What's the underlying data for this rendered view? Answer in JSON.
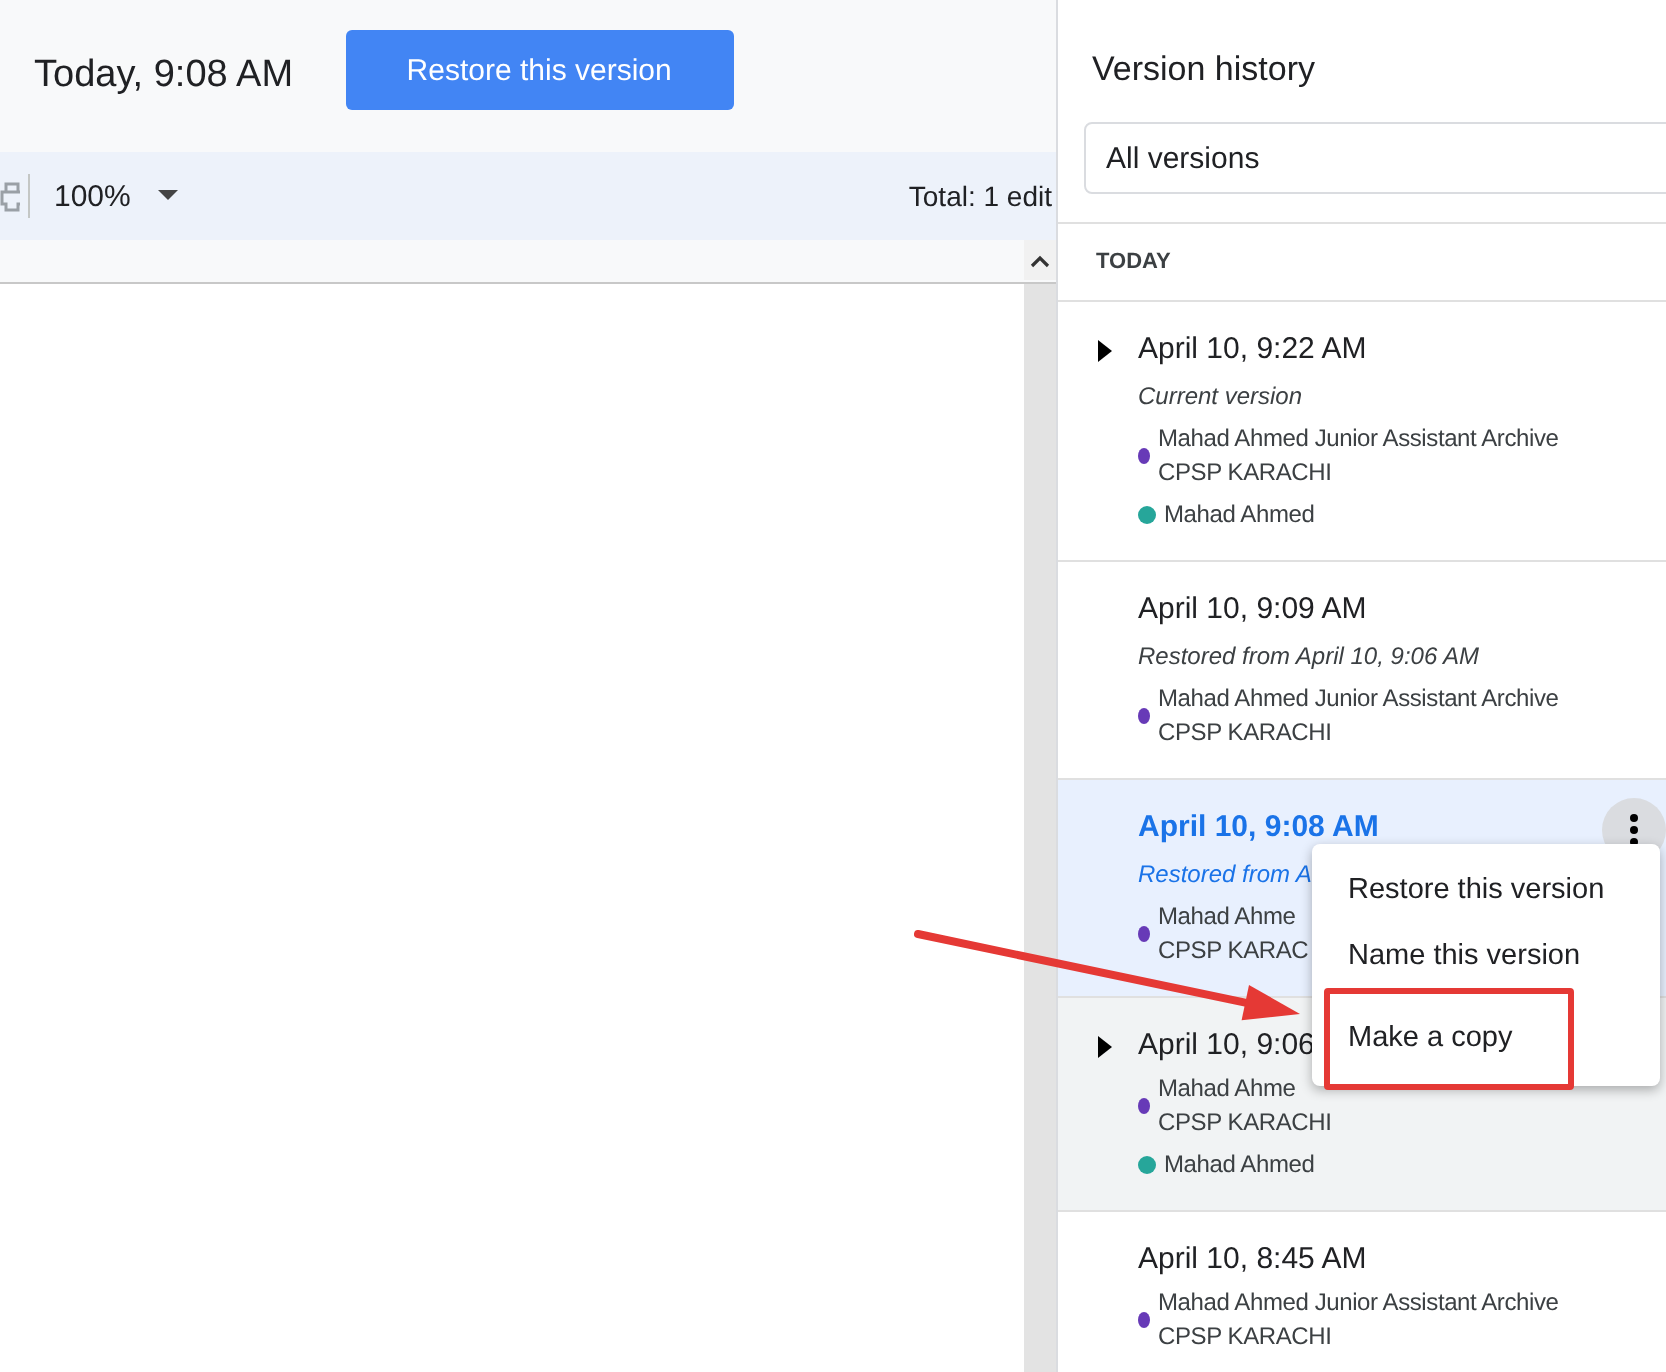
{
  "header": {
    "title": "Today, 9:08 AM",
    "restore_button": "Restore this version"
  },
  "toolbar": {
    "zoom": "100%",
    "total": "Total: 1 edit"
  },
  "panel": {
    "title": "Version history",
    "filter": "All versions",
    "section": "TODAY",
    "versions": [
      {
        "time": "April 10, 9:22 AM",
        "note": "Current version",
        "expandable": true,
        "selected": false,
        "hovered": false,
        "editors": [
          {
            "lines": [
              "Mahad Ahmed Junior Assistant Archive",
              "CPSP KARACHI"
            ],
            "color": "#673ab7"
          },
          {
            "lines": [
              "Mahad Ahmed"
            ],
            "color": "#26a69a"
          }
        ]
      },
      {
        "time": "April 10, 9:09 AM",
        "note": "Restored from April 10, 9:06 AM",
        "expandable": false,
        "selected": false,
        "hovered": false,
        "editors": [
          {
            "lines": [
              "Mahad Ahmed Junior Assistant Archive",
              "CPSP KARACHI"
            ],
            "color": "#673ab7"
          }
        ]
      },
      {
        "time": "April 10, 9:08 AM",
        "note": "Restored from A",
        "expandable": false,
        "selected": true,
        "hovered": false,
        "editors": [
          {
            "lines": [
              "Mahad Ahme",
              "CPSP KARAC"
            ],
            "color": "#673ab7"
          }
        ]
      },
      {
        "time": "April 10, 9:06",
        "expandable": true,
        "selected": false,
        "hovered": true,
        "editors": [
          {
            "lines": [
              "Mahad Ahme",
              "CPSP KARACHI"
            ],
            "color": "#673ab7"
          },
          {
            "lines": [
              "Mahad Ahmed"
            ],
            "color": "#26a69a"
          }
        ]
      },
      {
        "time": "April 10, 8:45 AM",
        "expandable": false,
        "selected": false,
        "hovered": false,
        "editors": [
          {
            "lines": [
              "Mahad Ahmed Junior Assistant Archive",
              "CPSP KARACHI"
            ],
            "color": "#673ab7"
          }
        ]
      }
    ]
  },
  "menu": {
    "items": [
      {
        "label": "Restore this version",
        "highlighted": false
      },
      {
        "label": "Name this version",
        "highlighted": false
      },
      {
        "label": "Make a copy",
        "highlighted": true
      }
    ]
  }
}
